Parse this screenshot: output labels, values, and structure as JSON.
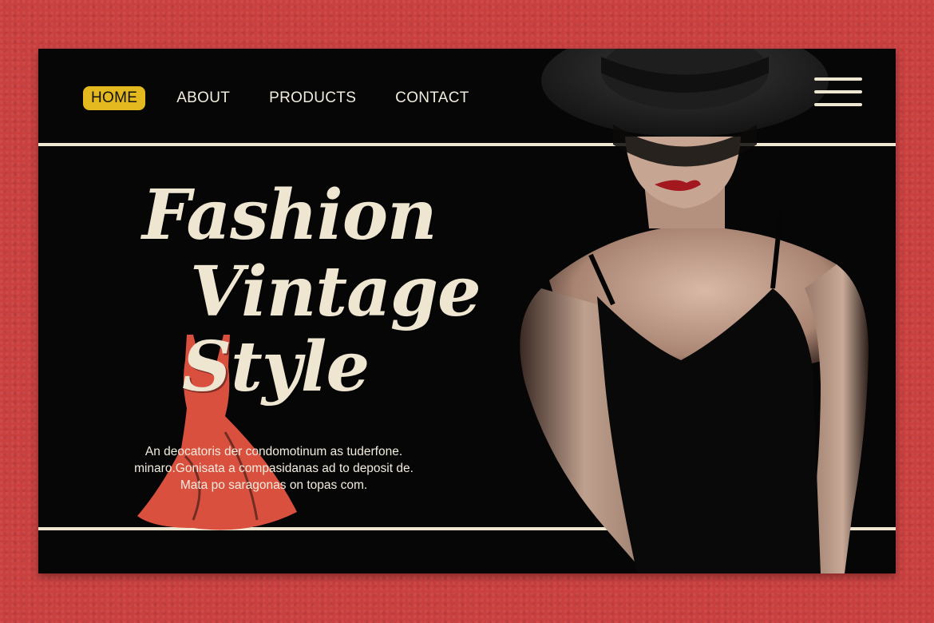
{
  "nav": {
    "items": [
      {
        "label": "HOME",
        "active": true
      },
      {
        "label": "ABOUT",
        "active": false
      },
      {
        "label": "PRODUCTS",
        "active": false
      },
      {
        "label": "CONTACT",
        "active": false
      }
    ],
    "menu_icon": "hamburger-menu-icon"
  },
  "hero": {
    "title_lines": [
      "Fashion",
      "Vintage",
      "Style"
    ],
    "description_lines": [
      "An deocatoris der condomotinum as tuderfone.",
      "minaro.Gonisata a compasidanas ad to deposit de.",
      "Mata po saragonas on topas com."
    ],
    "logo": "dress-icon"
  },
  "colors": {
    "background": "#c9403f",
    "panel": "#070606",
    "cream": "#efe6d2",
    "accent_yellow": "#e3b91f",
    "dress_coral": "#d9503e"
  }
}
